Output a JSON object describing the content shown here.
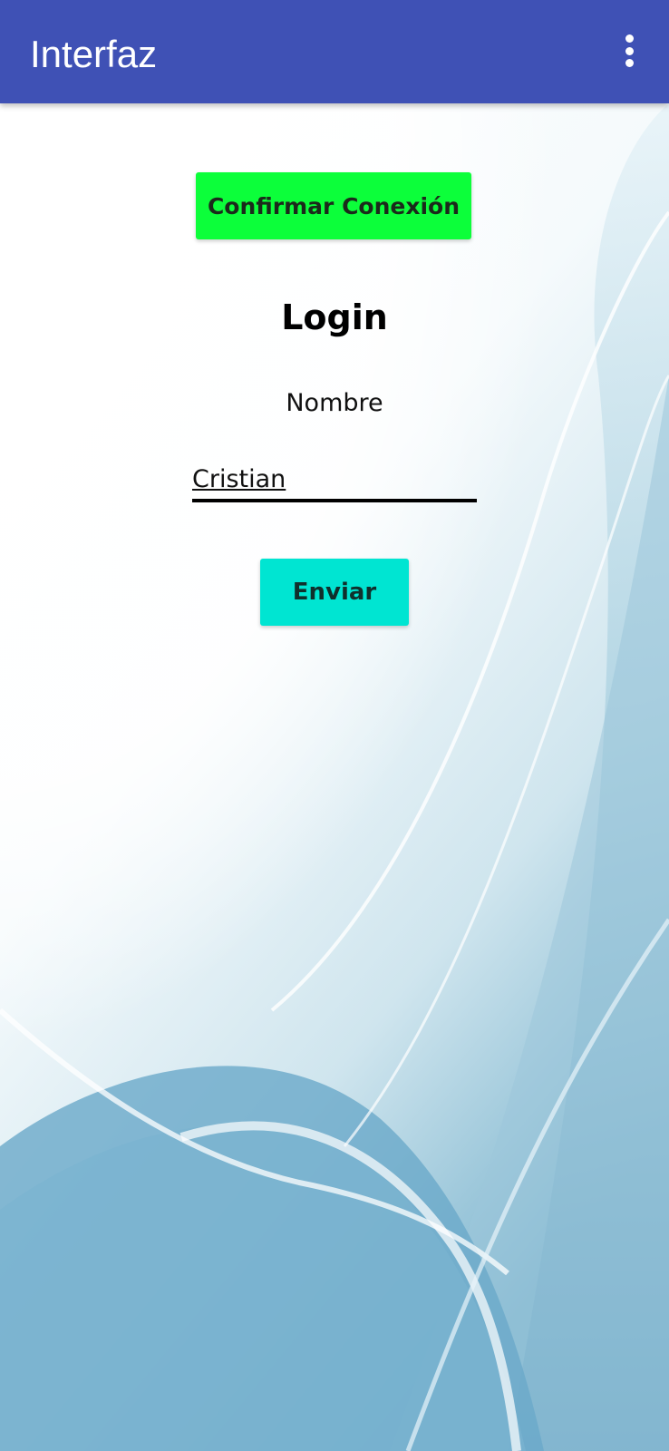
{
  "app_bar": {
    "title": "Interfaz",
    "menu_icon": "more-vert-icon",
    "color": "#3f51b5"
  },
  "main": {
    "confirm_button_label": "Confirmar Conexión",
    "confirm_button_color": "#0cff3a",
    "login_title": "Login",
    "name_label": "Nombre",
    "name_input_value": "Cristian",
    "send_button_label": "Enviar",
    "send_button_color": "#00e5d2"
  },
  "background": {
    "image": "abstract-blue-wave-background"
  }
}
